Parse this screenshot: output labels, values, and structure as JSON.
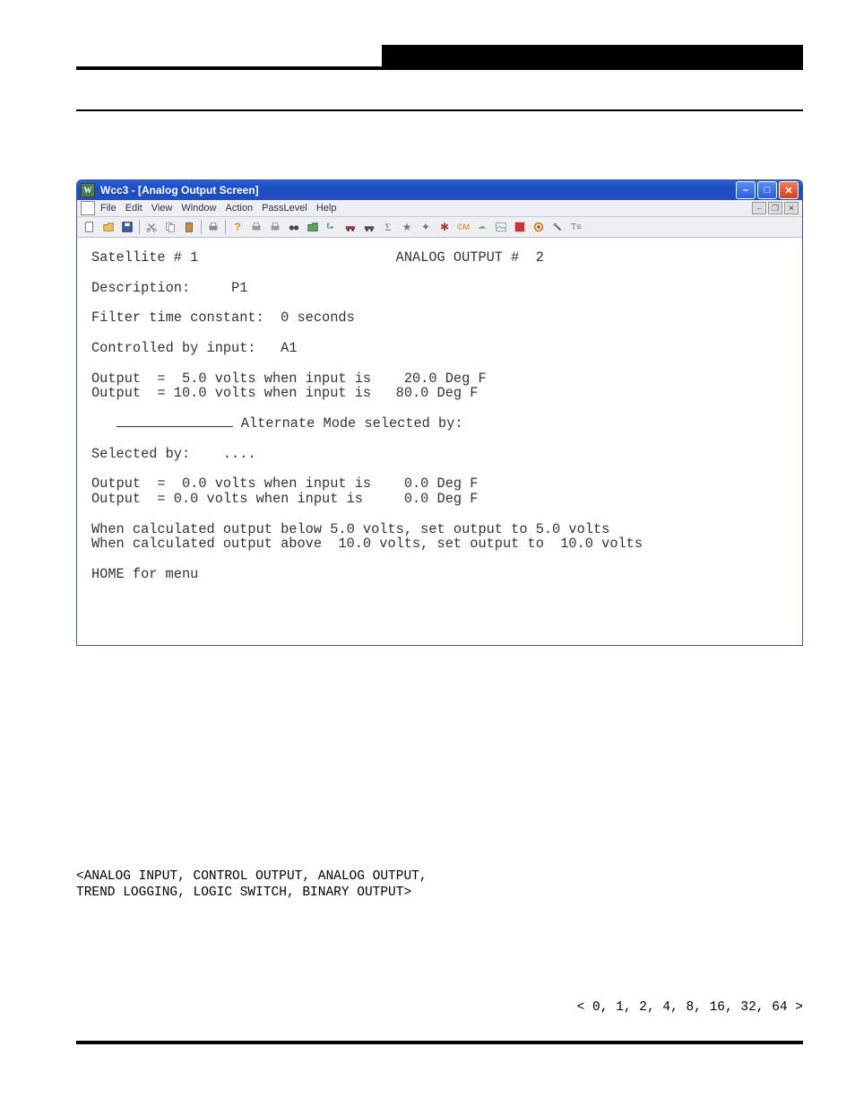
{
  "window": {
    "title": "Wcc3 - [Analog Output Screen]",
    "app_icon": "W"
  },
  "menubar": {
    "items": [
      "File",
      "Edit",
      "View",
      "Window",
      "Action",
      "PassLevel",
      "Help"
    ]
  },
  "toolbar": {
    "icons": [
      "new-icon",
      "open-icon",
      "save-icon",
      "cut-icon",
      "copy-icon",
      "paste-icon",
      "print-icon",
      "help-icon",
      "printer1-icon",
      "printer2-icon",
      "binoculars-icon",
      "folder-icon",
      "tree-icon",
      "car1-icon",
      "car2-icon",
      "sigma-icon",
      "star1-icon",
      "star2-icon",
      "gear-icon",
      "cm-icon",
      "bird-icon",
      "pic-icon",
      "color1-icon",
      "target-icon",
      "tool-icon",
      "t-icon"
    ]
  },
  "screen": {
    "satellite_label": "Satellite # 1",
    "output_label": "ANALOG OUTPUT #  2",
    "description_label": "Description:",
    "description_value": "P1",
    "filter_label": "Filter time constant:",
    "filter_value": "0 seconds",
    "controlled_label": "Controlled by input:",
    "controlled_value": "A1",
    "out_line1": "Output  =  5.0 volts when input is    20.0 Deg F",
    "out_line2": "Output  = 10.0 volts when input is   80.0 Deg F",
    "alt_mode_label": " Alternate Mode selected by:",
    "selected_by_label": "Selected by:",
    "selected_by_value": "....",
    "alt_line1": "Output  =  0.0 volts when input is    0.0 Deg F",
    "alt_line2": "Output  = 0.0 volts when input is     0.0 Deg F",
    "clamp_line1": "When calculated output below 5.0 volts, set output to 5.0 volts",
    "clamp_line2": "When calculated output above  10.0 volts, set output to  10.0 volts",
    "home_label": "HOME for menu"
  },
  "footer": {
    "list1": "<ANALOG INPUT, CONTROL OUTPUT, ANALOG OUTPUT,",
    "list2": " TREND LOGGING, LOGIC SWITCH, BINARY OUTPUT>",
    "options": "< 0, 1, 2, 4, 8, 16, 32, 64 >"
  }
}
